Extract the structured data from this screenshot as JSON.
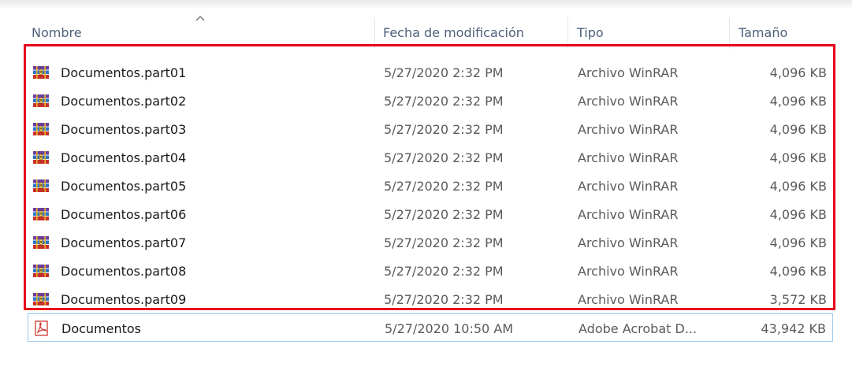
{
  "columns": {
    "name": "Nombre",
    "date": "Fecha de modificación",
    "type": "Tipo",
    "size": "Tamaño"
  },
  "icons": {
    "sort": "chevron-up-icon",
    "rar": "winrar-archive-icon",
    "pdf": "pdf-file-icon"
  },
  "colors": {
    "highlight_box": "#e8001c",
    "header_text": "#4c607a",
    "focus_outline": "#99c9ef"
  },
  "files": [
    {
      "name": "Documentos.part01",
      "date": "5/27/2020 2:32 PM",
      "type": "Archivo WinRAR",
      "size": "4,096 KB",
      "icon": "rar"
    },
    {
      "name": "Documentos.part02",
      "date": "5/27/2020 2:32 PM",
      "type": "Archivo WinRAR",
      "size": "4,096 KB",
      "icon": "rar"
    },
    {
      "name": "Documentos.part03",
      "date": "5/27/2020 2:32 PM",
      "type": "Archivo WinRAR",
      "size": "4,096 KB",
      "icon": "rar"
    },
    {
      "name": "Documentos.part04",
      "date": "5/27/2020 2:32 PM",
      "type": "Archivo WinRAR",
      "size": "4,096 KB",
      "icon": "rar"
    },
    {
      "name": "Documentos.part05",
      "date": "5/27/2020 2:32 PM",
      "type": "Archivo WinRAR",
      "size": "4,096 KB",
      "icon": "rar"
    },
    {
      "name": "Documentos.part06",
      "date": "5/27/2020 2:32 PM",
      "type": "Archivo WinRAR",
      "size": "4,096 KB",
      "icon": "rar"
    },
    {
      "name": "Documentos.part07",
      "date": "5/27/2020 2:32 PM",
      "type": "Archivo WinRAR",
      "size": "4,096 KB",
      "icon": "rar"
    },
    {
      "name": "Documentos.part08",
      "date": "5/27/2020 2:32 PM",
      "type": "Archivo WinRAR",
      "size": "4,096 KB",
      "icon": "rar"
    },
    {
      "name": "Documentos.part09",
      "date": "5/27/2020 2:32 PM",
      "type": "Archivo WinRAR",
      "size": "3,572 KB",
      "icon": "rar"
    },
    {
      "name": "Documentos",
      "date": "5/27/2020 10:50 AM",
      "type": "Adobe Acrobat D...",
      "size": "43,942 KB",
      "icon": "pdf"
    }
  ]
}
